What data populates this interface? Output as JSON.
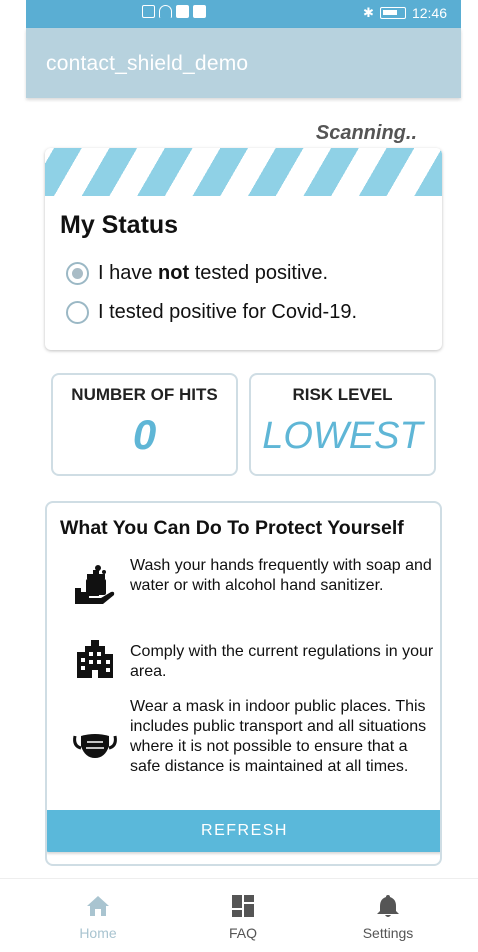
{
  "statusbar": {
    "time": "12:46",
    "bluetooth": "✱"
  },
  "appbar": {
    "title": "contact_shield_demo"
  },
  "scan": {
    "status_text": "Scanning.."
  },
  "my_status": {
    "title": "My Status",
    "option1": {
      "before": "I have ",
      "bold": "not",
      "after": " tested positive."
    },
    "option2": "I tested positive for Covid-19.",
    "selected": 1
  },
  "metrics": {
    "hits_label": "NUMBER OF HITS",
    "hits_value": "0",
    "risk_label": "RISK LEVEL",
    "risk_value": "LOWEST"
  },
  "protect": {
    "title": "What You Can Do To Protect Yourself",
    "tips": [
      {
        "text": "Wash your hands frequently with soap and water or with alcohol hand sanitizer.",
        "icon": "hand-wash-icon"
      },
      {
        "text": "Comply with the current regulations in your area.",
        "icon": "building-icon"
      },
      {
        "text": "Wear a mask in indoor public places. This includes public transport and all situations where it is not possible to ensure that a safe distance is maintained at all times.",
        "icon": "mask-icon"
      }
    ],
    "refresh_label": "REFRESH"
  },
  "nav": {
    "items": [
      {
        "label": "Home",
        "icon": "home-icon",
        "active": true
      },
      {
        "label": "FAQ",
        "icon": "faq-icon",
        "active": false
      },
      {
        "label": "Settings",
        "icon": "bell-icon",
        "active": false
      }
    ]
  },
  "colors": {
    "status_bar": "#5aaed3",
    "app_bar": "#b7d2de",
    "accent": "#5ab8da",
    "stripe": "#8fd1e6"
  }
}
